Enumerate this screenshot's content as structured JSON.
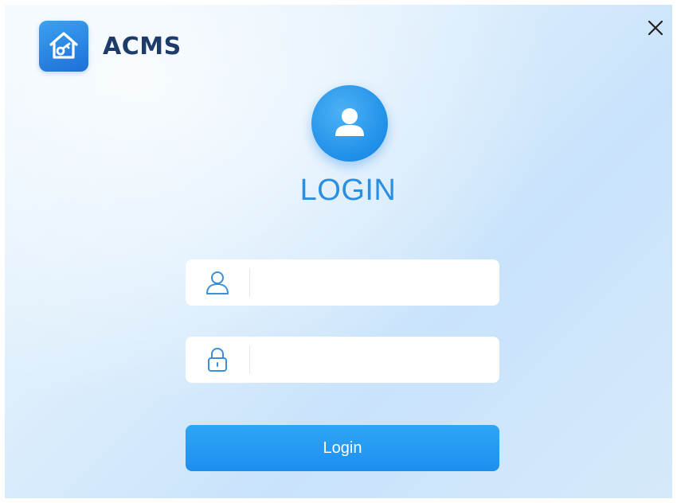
{
  "app": {
    "brand_name": "ACMS",
    "logo_icon": "house-key-icon"
  },
  "window": {
    "close_icon": "close-icon"
  },
  "login": {
    "avatar_icon": "user-avatar-icon",
    "title": "LOGIN",
    "username": {
      "icon": "user-icon",
      "value": "",
      "placeholder": ""
    },
    "password": {
      "icon": "lock-icon",
      "value": "",
      "placeholder": ""
    },
    "button_label": "Login"
  },
  "colors": {
    "accent": "#1d8ef0",
    "title": "#2a8fe0",
    "brand_text": "#1d3c6a",
    "icon_outline": "#3a8fdc"
  }
}
